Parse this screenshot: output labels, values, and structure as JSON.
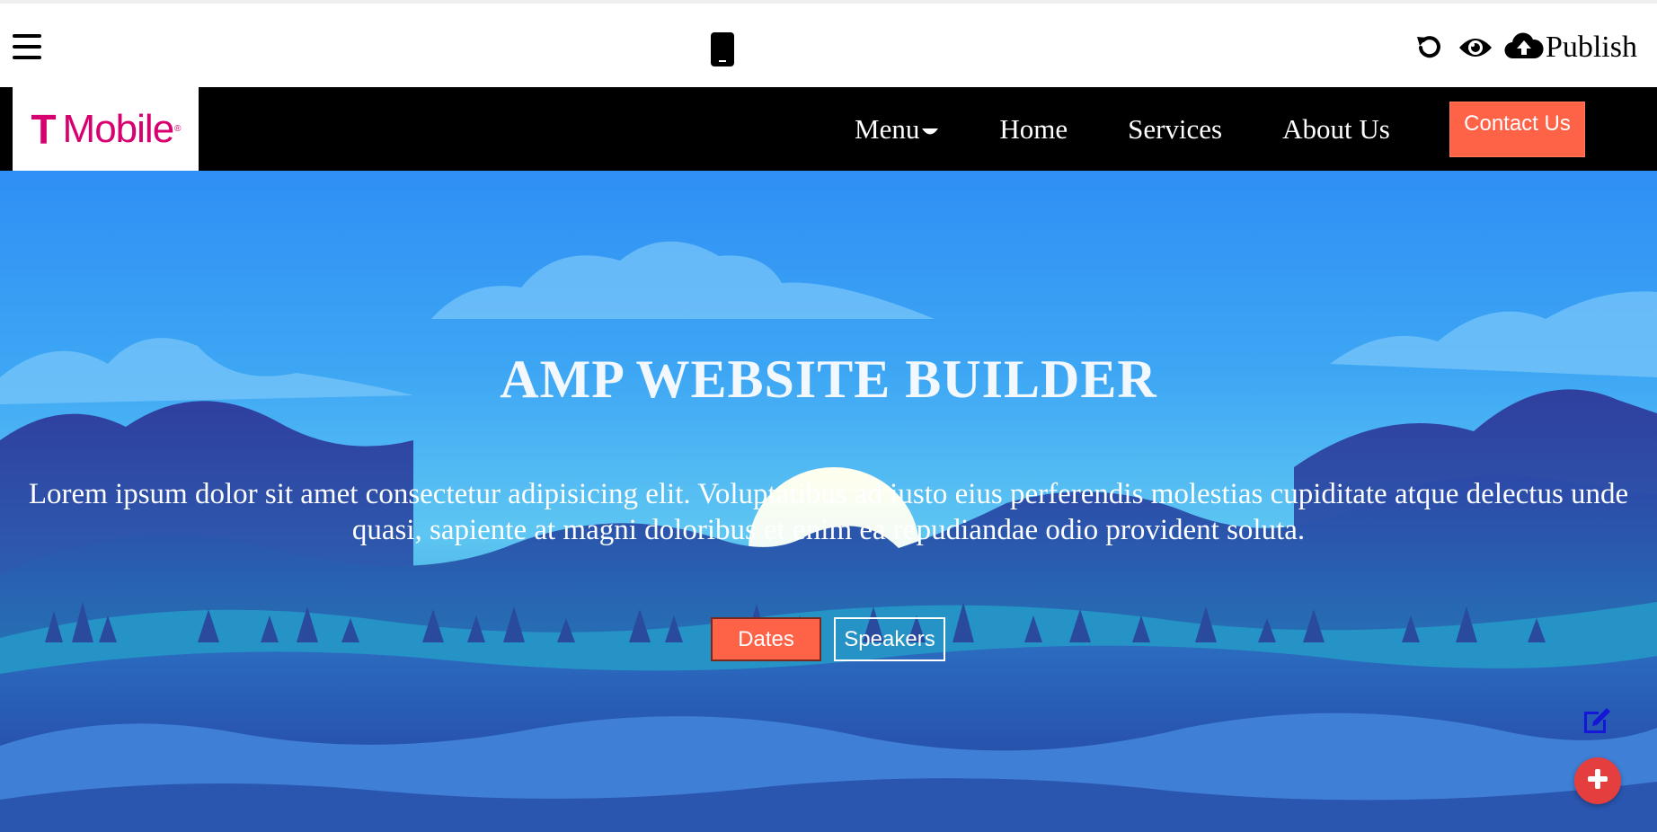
{
  "toolbar": {
    "menu_icon": "hamburger-icon",
    "device_icon": "mobile-phone-icon",
    "undo_icon": "undo-icon",
    "preview_icon": "eye-icon",
    "publish_icon": "cloud-upload-icon",
    "publish_label": "Publish"
  },
  "navbar": {
    "logo_text": "Mobile",
    "logo_t": "T",
    "logo_color": "#d6006e",
    "links": [
      {
        "label": "Menu",
        "has_dropdown": true
      },
      {
        "label": "Home"
      },
      {
        "label": "Services"
      },
      {
        "label": "About Us"
      }
    ],
    "contact_label": "Contact Us",
    "contact_color": "#ff6347"
  },
  "hero": {
    "title": "AMP WEBSITE BUILDER",
    "description": "Lorem ipsum dolor sit amet consectetur adipisicing elit. Voluptatibus ad iusto eius perferendis molestias cupiditate atque delectus unde quasi, sapiente at magni doloribus et enim ea repudiandae odio provident soluta.",
    "primary_button": "Dates",
    "secondary_button": "Speakers",
    "edit_icon": "edit-icon",
    "add_icon": "plus-icon",
    "add_button_color": "#e53e3e"
  }
}
